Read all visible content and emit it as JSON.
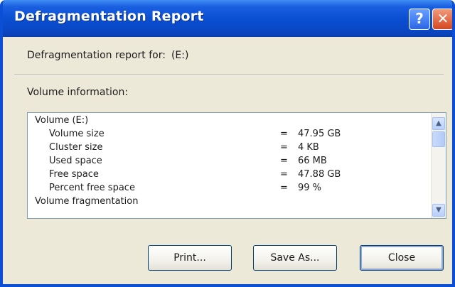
{
  "window": {
    "title": "Defragmentation Report",
    "help_glyph": "?",
    "close_glyph": "✕"
  },
  "report": {
    "label": "Defragmentation report for:",
    "drive": "(E:)"
  },
  "volume_info_label": "Volume information:",
  "list": {
    "rows": [
      {
        "label": "Volume  (E:)",
        "eq": "",
        "value": "",
        "indent": 0
      },
      {
        "label": "Volume size",
        "eq": "=",
        "value": "47.95 GB",
        "indent": 1
      },
      {
        "label": "Cluster size",
        "eq": "=",
        "value": "4 KB",
        "indent": 1
      },
      {
        "label": "Used space",
        "eq": "=",
        "value": "66 MB",
        "indent": 1
      },
      {
        "label": "Free space",
        "eq": "=",
        "value": "47.88 GB",
        "indent": 1
      },
      {
        "label": "Percent free space",
        "eq": "=",
        "value": "99 %",
        "indent": 1
      },
      {
        "label": "Volume fragmentation",
        "eq": "",
        "value": "",
        "indent": 0
      }
    ]
  },
  "icons": {
    "scroll_up": "up-arrow-icon",
    "scroll_down": "down-arrow-icon"
  },
  "buttons": {
    "print": "Print...",
    "save_as": "Save As...",
    "close": "Close"
  }
}
